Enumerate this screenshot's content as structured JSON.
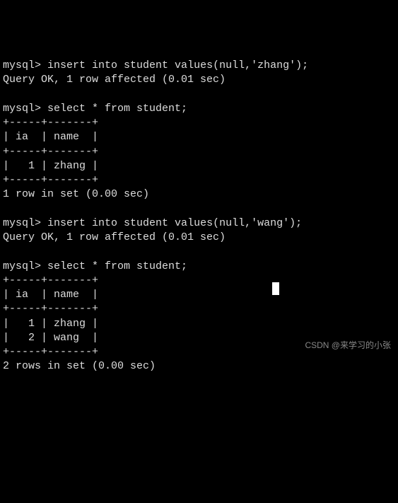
{
  "session": {
    "prompt": "mysql>",
    "cmd_insert1": "insert into student values(null,'zhang');",
    "result_insert1": "Query OK, 1 row affected (0.01 sec)",
    "cmd_select1": "select * from student;",
    "table1": {
      "border_top": "+-----+-------+",
      "header": "| ia  | name  |",
      "border_mid": "+-----+-------+",
      "row1": "|   1 | zhang |",
      "border_bot": "+-----+-------+"
    },
    "result_select1": "1 row in set (0.00 sec)",
    "cmd_insert2": "insert into student values(null,'wang');",
    "result_insert2": "Query OK, 1 row affected (0.01 sec)",
    "cmd_select2": "select * from student;",
    "table2": {
      "border_top": "+-----+-------+",
      "header": "| ia  | name  |",
      "border_mid": "+-----+-------+",
      "row1": "|   1 | zhang |",
      "row2": "|   2 | wang  |",
      "border_bot": "+-----+-------+"
    },
    "result_select2": "2 rows in set (0.00 sec)"
  },
  "watermark": "CSDN @来学习的小张"
}
